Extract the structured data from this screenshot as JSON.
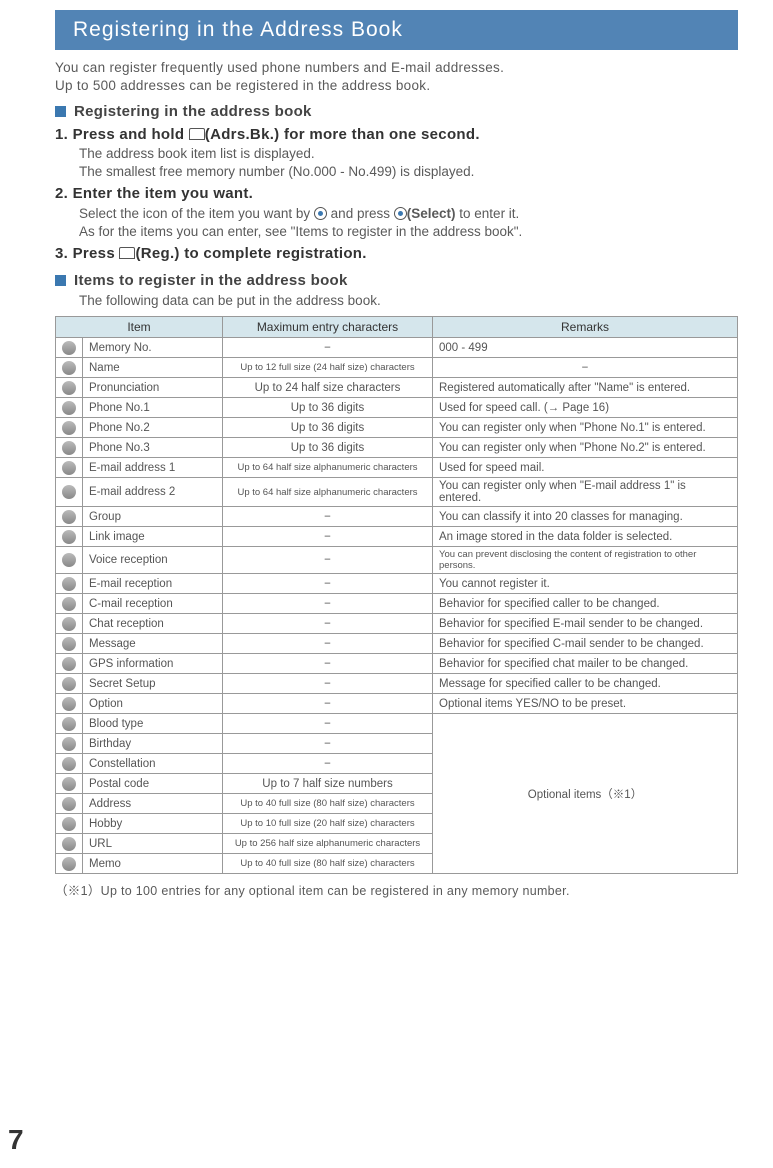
{
  "title": "Registering in the Address Book",
  "intro": [
    "You can register frequently used phone numbers and E-mail addresses.",
    "Up to 500 addresses can be registered in the address book."
  ],
  "section1": "Registering in the address book",
  "steps": {
    "s1": {
      "num": "1.",
      "pre": "Press and hold",
      "key": "(Adrs.Bk.)",
      "post": "for more than one second."
    },
    "s1b": [
      "The address book item list is displayed.",
      "The smallest free memory number (No.000 - No.499) is displayed."
    ],
    "s2": {
      "num": "2.",
      "text": "Enter the item you want."
    },
    "s2b": [
      "Select the icon of the item you want by",
      "and press",
      "(Select)",
      "to enter it.",
      "As for the items you can enter, see \"Items to register in the address book\"."
    ],
    "s3": {
      "num": "3.",
      "pre": "Press",
      "key": "(Reg.)",
      "post": "to complete registration."
    }
  },
  "section2": "Items to register in the address book",
  "section2sub": "The following data can be put in the address book.",
  "headers": {
    "item": "Item",
    "max": "Maximum entry characters",
    "rem": "Remarks"
  },
  "rows": [
    {
      "item": "Memory No.",
      "max": "−",
      "rem": "000 - 499"
    },
    {
      "item": "Name",
      "max": "Up to 12 full size (24 half size) characters",
      "rem": "−",
      "tiny": true,
      "remcenter": true
    },
    {
      "item": "Pronunciation",
      "max": "Up to 24 half size characters",
      "rem": "Registered automatically after \"Name\" is entered."
    },
    {
      "item": "Phone No.1",
      "max": "Up to 36 digits",
      "rem": "Used for speed call. (→ Page 16)"
    },
    {
      "item": "Phone No.2",
      "max": "Up to 36 digits",
      "rem": "You can register only when \"Phone No.1\" is entered."
    },
    {
      "item": "Phone No.3",
      "max": "Up to 36 digits",
      "rem": "You can register only when \"Phone No.2\" is entered."
    },
    {
      "item": "E-mail address 1",
      "max": "Up to 64 half size alphanumeric characters",
      "rem": "Used for speed mail.",
      "tiny": true
    },
    {
      "item": "E-mail address 2",
      "max": "Up to 64 half size alphanumeric characters",
      "rem": "You can register only when \"E-mail address 1\" is entered.",
      "tiny": true
    },
    {
      "item": "Group",
      "max": "−",
      "rem": "You can classify it into 20 classes for managing."
    },
    {
      "item": "Link image",
      "max": "−",
      "rem": "An image stored in the data folder is selected."
    },
    {
      "item": "Voice reception",
      "max": "−",
      "rem": "You can prevent disclosing the content of registration to other persons.",
      "remtiny": true
    },
    {
      "item": "E-mail reception",
      "max": "−",
      "rem": "You cannot register it."
    },
    {
      "item": "C-mail reception",
      "max": "−",
      "rem": "Behavior for specified caller to be changed."
    },
    {
      "item": "Chat reception",
      "max": "−",
      "rem": "Behavior for specified E-mail sender to be changed."
    },
    {
      "item": "Message",
      "max": "−",
      "rem": "Behavior for specified C-mail sender to be changed."
    },
    {
      "item": "GPS information",
      "max": "−",
      "rem": "Behavior for specified chat mailer to be changed."
    },
    {
      "item": "Secret Setup",
      "max": "−",
      "rem": "Message for specified caller to be changed."
    },
    {
      "item": "Option",
      "max": "−",
      "rem": "Optional items YES/NO to be preset."
    }
  ],
  "optrows": [
    {
      "item": "Blood type",
      "max": "−"
    },
    {
      "item": "Birthday",
      "max": "−"
    },
    {
      "item": "Constellation",
      "max": "−"
    },
    {
      "item": "Postal code",
      "max": "Up to 7 half size numbers"
    },
    {
      "item": "Address",
      "max": "Up to 40 full size (80 half size) characters",
      "tiny": true
    },
    {
      "item": "Hobby",
      "max": "Up to 10 full size (20 half size) characters",
      "tiny": true
    },
    {
      "item": "URL",
      "max": "Up to 256 half size alphanumeric characters",
      "tiny": true
    },
    {
      "item": "Memo",
      "max": "Up to 40 full size (80 half size) characters",
      "tiny": true
    }
  ],
  "optremark": "Optional items（※1）",
  "note": "（※1）Up to 100 entries for any optional item can be registered in any memory number.",
  "pagenum": "7"
}
